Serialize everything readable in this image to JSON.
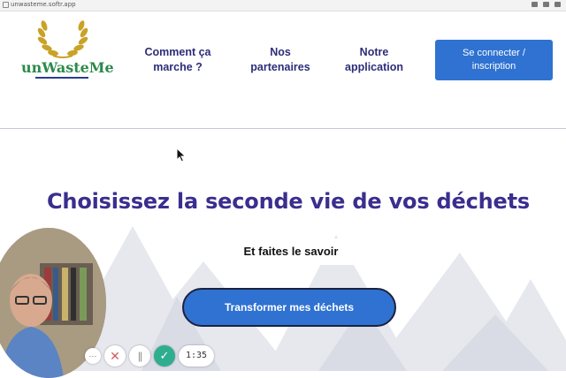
{
  "browser": {
    "url": "unwasteme.softr.app"
  },
  "header": {
    "logo_text": "unWasteMe",
    "nav": [
      {
        "line1": "Comment ça",
        "line2": "marche ?"
      },
      {
        "line1": "Nos",
        "line2": "partenaires"
      },
      {
        "line1": "Notre",
        "line2": "application"
      }
    ],
    "login": {
      "line1": "Se connecter /",
      "line2": "inscription"
    }
  },
  "hero": {
    "title": "Choisissez la seconde vie de vos déchets",
    "subtitle": "Et faites le savoir",
    "cta": "Transformer mes déchets"
  },
  "recorder": {
    "more": "···",
    "cancel": "✕",
    "pause": "||",
    "done": "✓",
    "timer": "1:35"
  },
  "colors": {
    "brand_blue": "#2f72d1",
    "nav_text": "#2d2d7a",
    "title_purple": "#3a2e8e",
    "logo_green": "#2b8a4a",
    "check_green": "#2fae8f"
  },
  "icons": [
    "lock-icon",
    "laurel-wreath-icon",
    "mouse-cursor-icon",
    "more-icon",
    "close-icon",
    "pause-icon",
    "check-icon"
  ]
}
